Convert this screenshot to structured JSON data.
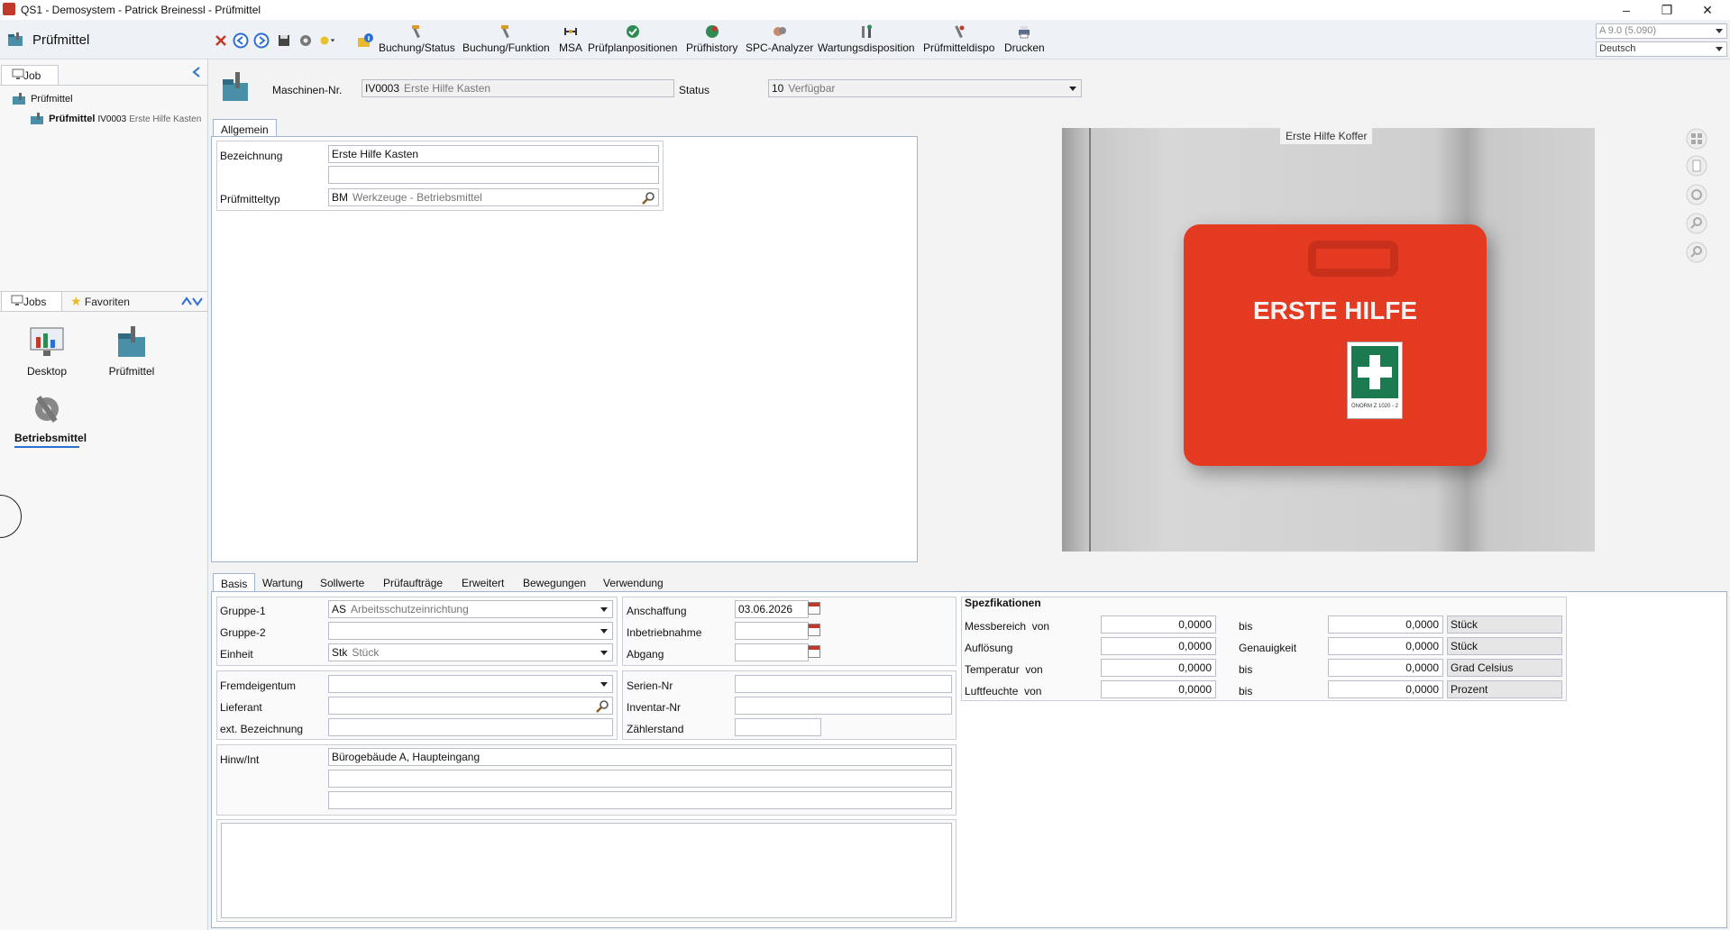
{
  "window": {
    "title": "QS1 - Demosystem - Patrick Breinessl - Prüfmittel",
    "controls": [
      "–",
      "❐",
      "✕"
    ]
  },
  "module": {
    "title": "Prüfmittel",
    "toolbar": [
      {
        "label": "Buchung/Status",
        "icon": "booking-status-icon"
      },
      {
        "label": "Buchung/Funktion",
        "icon": "booking-function-icon"
      },
      {
        "label": "MSA",
        "icon": "msa-icon"
      },
      {
        "label": "Prüfplanpositionen",
        "icon": "inspection-plan-icon"
      },
      {
        "label": "Prüfhistory",
        "icon": "history-icon"
      },
      {
        "label": "SPC-Analyzer",
        "icon": "spc-icon"
      },
      {
        "label": "Wartungsdisposition",
        "icon": "maintenance-icon"
      },
      {
        "label": "Prüfmitteldispo",
        "icon": "dispo-icon"
      },
      {
        "label": "Drucken",
        "icon": "print-icon"
      }
    ],
    "version": "A 9.0 (5.090)",
    "language": "Deutsch"
  },
  "left": {
    "job_tab": "Job",
    "tree": {
      "root": "Prüfmittel",
      "child": "Prüfmittel",
      "child_code": "IV0003",
      "child_desc": "Erste Hilfe Kasten"
    },
    "tabs": {
      "jobs": "Jobs",
      "favorites": "Favoriten"
    },
    "jobs": [
      {
        "label": "Desktop"
      },
      {
        "label": "Prüfmittel"
      },
      {
        "label": "Betriebsmittel"
      }
    ]
  },
  "header": {
    "machine_label": "Maschinen-Nr.",
    "machine_code": "IV0003",
    "machine_desc": "Erste Hilfe Kasten",
    "status_label": "Status",
    "status_code": "10",
    "status_desc": "Verfügbar"
  },
  "general": {
    "tab": "Allgemein",
    "bezeichnung_label": "Bezeichnung",
    "bezeichnung": "Erste Hilfe Kasten",
    "bezeichnung2": "",
    "typ_label": "Prüfmitteltyp",
    "typ_code": "BM",
    "typ_desc": "Werkzeuge - Betriebsmittel"
  },
  "image": {
    "caption": "Erste Hilfe Koffer",
    "box_text": "ERSTE HILFE",
    "norm_text": "ÖNORM Z 1020 - 2"
  },
  "detail_tabs": [
    "Basis",
    "Wartung",
    "Sollwerte",
    "Prüfaufträge",
    "Erweitert",
    "Bewegungen",
    "Verwendung"
  ],
  "basis": {
    "gruppe1_label": "Gruppe-1",
    "gruppe1_code": "AS",
    "gruppe1_desc": "Arbeitsschutzeinrichtung",
    "gruppe2_label": "Gruppe-2",
    "einheit_label": "Einheit",
    "einheit_code": "Stk",
    "einheit_desc": "Stück",
    "fremd_label": "Fremdeigentum",
    "lieferant_label": "Lieferant",
    "extbez_label": "ext. Bezeichnung",
    "anschaffung_label": "Anschaffung",
    "anschaffung": "03.06.2026",
    "inbetrieb_label": "Inbetriebnahme",
    "abgang_label": "Abgang",
    "serien_label": "Serien-Nr",
    "inventar_label": "Inventar-Nr",
    "zaehler_label": "Zählerstand",
    "hinw_label": "Hinw/Int",
    "hinw1": "Bürogebäude A, Haupteingang"
  },
  "spec": {
    "title": "Spezfikationen",
    "rows": [
      {
        "label": "Messbereich",
        "sub": "von",
        "v1": "0,0000",
        "mid": "bis",
        "v2": "0,0000",
        "unit": "Stück"
      },
      {
        "label": "Auflösung",
        "sub": "",
        "v1": "0,0000",
        "mid": "Genauigkeit",
        "v2": "0,0000",
        "unit": "Stück"
      },
      {
        "label": "Temperatur",
        "sub": "von",
        "v1": "0,0000",
        "mid": "bis",
        "v2": "0,0000",
        "unit": "Grad Celsius"
      },
      {
        "label": "Luftfeuchte",
        "sub": "von",
        "v1": "0,0000",
        "mid": "bis",
        "v2": "0,0000",
        "unit": "Prozent"
      }
    ]
  }
}
